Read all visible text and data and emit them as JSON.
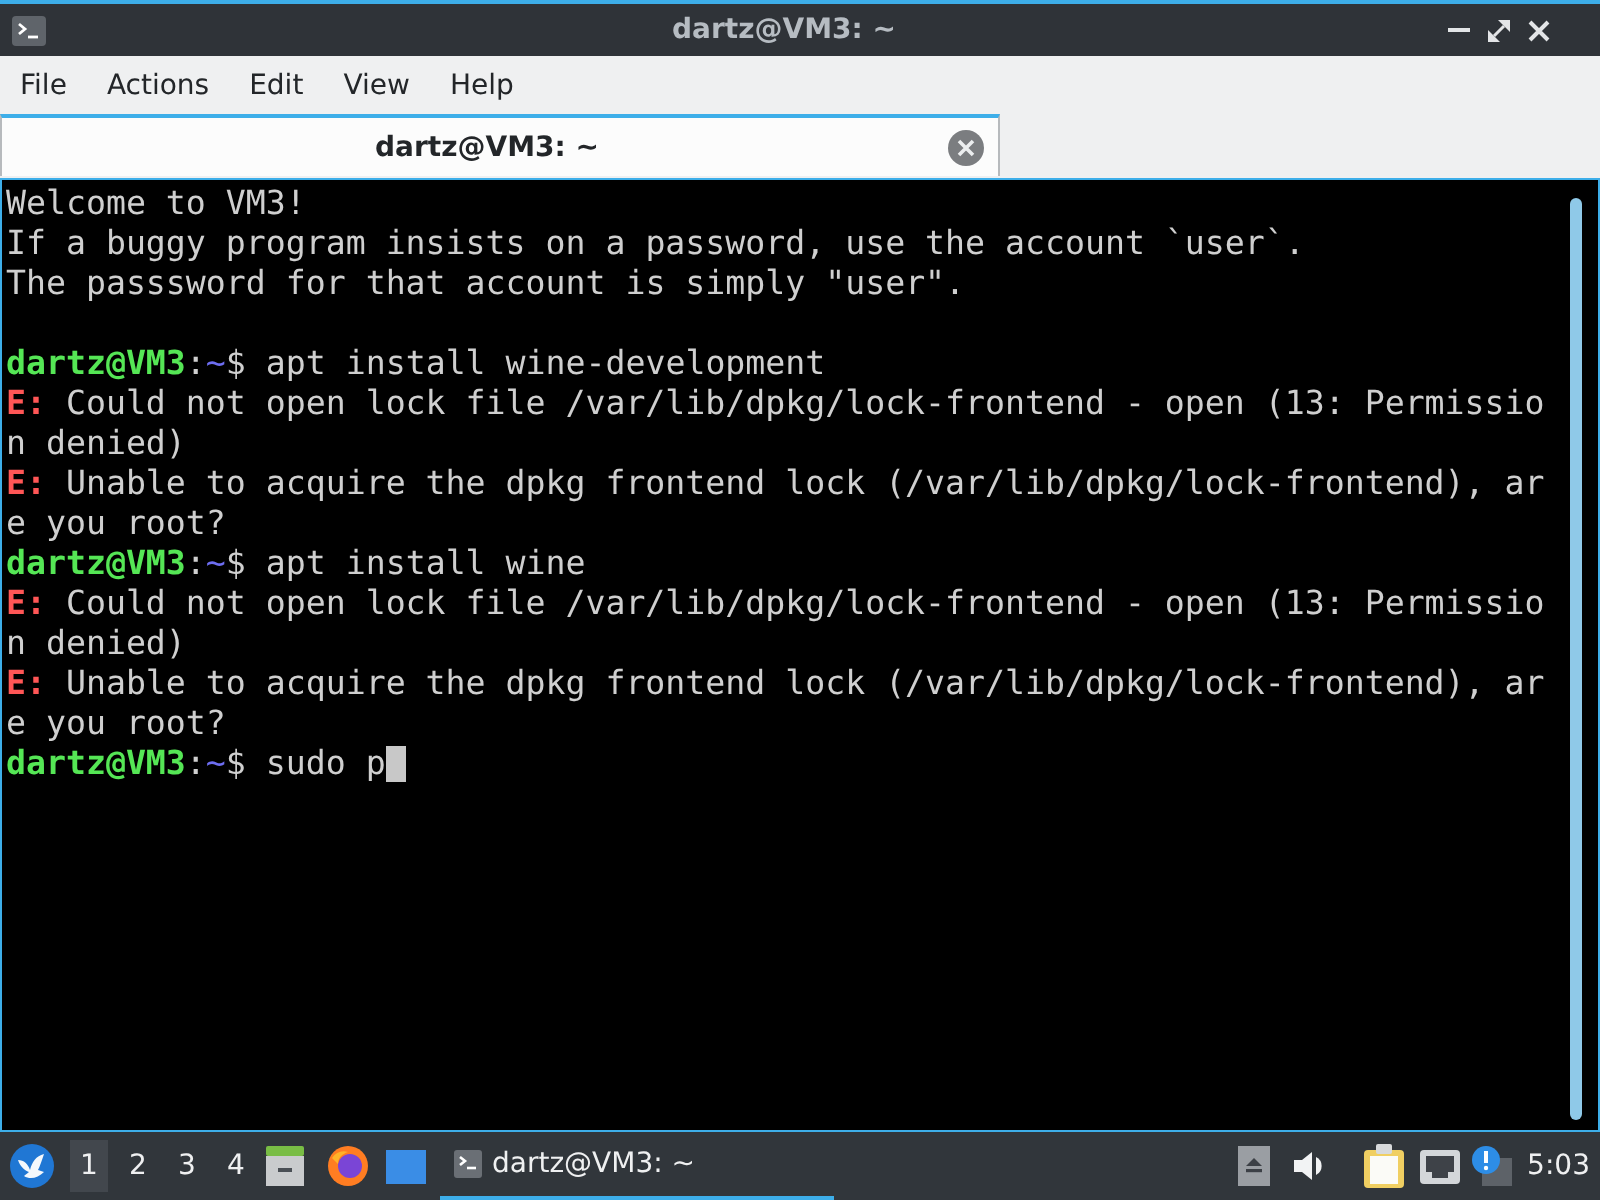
{
  "window": {
    "title": "dartz@VM3: ~"
  },
  "menu": [
    "File",
    "Actions",
    "Edit",
    "View",
    "Help"
  ],
  "tabs": [
    {
      "label": "dartz@VM3: ~",
      "selected": true
    }
  ],
  "terminal": {
    "lines": [
      {
        "kind": "plain",
        "text": "Welcome to VM3!"
      },
      {
        "kind": "plain",
        "text": "If a buggy program insists on a password, use the account `user`."
      },
      {
        "kind": "plain",
        "text": "The passsword for that account is simply \"user\"."
      },
      {
        "kind": "blank"
      },
      {
        "kind": "prompt",
        "user": "dartz@VM3",
        "separator": ":",
        "path": "~",
        "symbol": "$",
        "command": "apt install wine-development",
        "cursor": false
      },
      {
        "kind": "error",
        "prefix": "E:",
        "text": "Could not open lock file /var/lib/dpkg/lock-frontend - open (13: Permissio"
      },
      {
        "kind": "plain",
        "text": "n denied)"
      },
      {
        "kind": "error",
        "prefix": "E:",
        "text": "Unable to acquire the dpkg frontend lock (/var/lib/dpkg/lock-frontend), ar"
      },
      {
        "kind": "plain",
        "text": "e you root?"
      },
      {
        "kind": "prompt",
        "user": "dartz@VM3",
        "separator": ":",
        "path": "~",
        "symbol": "$",
        "command": "apt install wine",
        "cursor": false
      },
      {
        "kind": "error",
        "prefix": "E:",
        "text": "Could not open lock file /var/lib/dpkg/lock-frontend - open (13: Permissio"
      },
      {
        "kind": "plain",
        "text": "n denied)"
      },
      {
        "kind": "error",
        "prefix": "E:",
        "text": "Unable to acquire the dpkg frontend lock (/var/lib/dpkg/lock-frontend), ar"
      },
      {
        "kind": "plain",
        "text": "e you root?"
      },
      {
        "kind": "prompt",
        "user": "dartz@VM3",
        "separator": ":",
        "path": "~",
        "symbol": "$",
        "command": "sudo p",
        "cursor": true
      }
    ]
  },
  "taskbar": {
    "workspaces": [
      {
        "label": "1",
        "selected": true
      },
      {
        "label": "2",
        "selected": false
      },
      {
        "label": "3",
        "selected": false
      },
      {
        "label": "4",
        "selected": false
      }
    ],
    "tasks": [
      {
        "label": "dartz@VM3: ~",
        "selected": true
      }
    ],
    "clock": "5:03"
  }
}
